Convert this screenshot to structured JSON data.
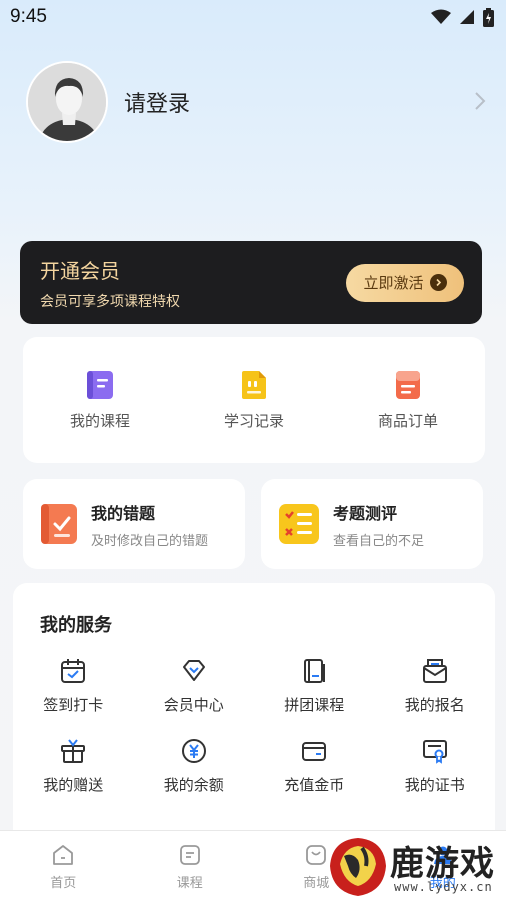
{
  "status": {
    "time": "9:45"
  },
  "profile": {
    "login_text": "请登录"
  },
  "vip": {
    "title": "开通会员",
    "subtitle": "会员可享多项课程特权",
    "button": "立即激活"
  },
  "quick": [
    {
      "label": "我的课程",
      "icon": "book-icon"
    },
    {
      "label": "学习记录",
      "icon": "document-icon"
    },
    {
      "label": "商品订单",
      "icon": "order-icon"
    }
  ],
  "mistakes": {
    "title": "我的错题",
    "subtitle": "及时修改自己的错题"
  },
  "exam": {
    "title": "考题测评",
    "subtitle": "查看自己的不足"
  },
  "services": {
    "title": "我的服务",
    "items": [
      {
        "label": "签到打卡",
        "icon": "calendar-check-icon"
      },
      {
        "label": "会员中心",
        "icon": "diamond-icon"
      },
      {
        "label": "拼团课程",
        "icon": "book-stack-icon"
      },
      {
        "label": "我的报名",
        "icon": "envelope-icon"
      },
      {
        "label": "我的赠送",
        "icon": "gift-icon"
      },
      {
        "label": "我的余额",
        "icon": "yuan-coin-icon"
      },
      {
        "label": "充值金币",
        "icon": "wallet-icon"
      },
      {
        "label": "我的证书",
        "icon": "certificate-icon"
      }
    ]
  },
  "tabs": [
    {
      "label": "首页",
      "icon": "home-icon"
    },
    {
      "label": "课程",
      "icon": "course-icon"
    },
    {
      "label": "商城",
      "icon": "shop-icon"
    },
    {
      "label": "我的",
      "icon": "profile-icon"
    }
  ],
  "watermark": {
    "text": "鹿游戏",
    "url": "www.lydyx.cn"
  },
  "colors": {
    "accent": "#2b7bf3",
    "vip_gold": "#f4d59f",
    "vip_dark": "#1d1d1f"
  }
}
